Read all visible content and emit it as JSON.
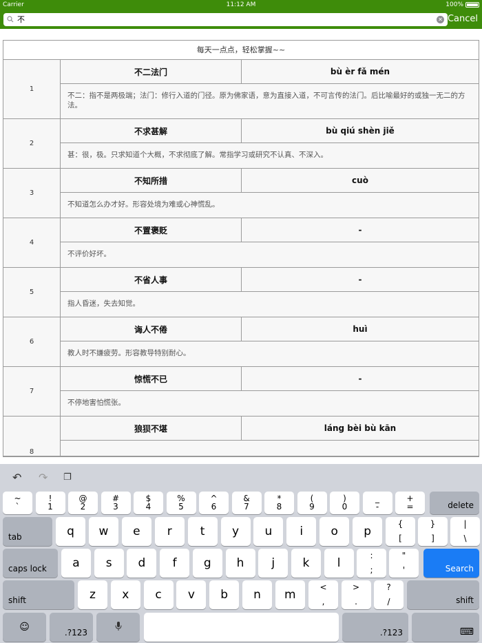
{
  "status": {
    "carrier": "Carrier",
    "time": "11:12 AM",
    "battery": "100%"
  },
  "search": {
    "value": "不",
    "cancel_label": "Cancel"
  },
  "table": {
    "title": "每天一点点，轻松掌握~~",
    "rows": [
      {
        "num": "1",
        "word": "不二法门",
        "pinyin": "bù èr fǎ mén",
        "meaning": "不二：指不是两极端；法门：修行入道的门径。原为佛家语，意为直接入道，不可言传的法门。后比喻最好的或独一无二的方法。"
      },
      {
        "num": "2",
        "word": "不求甚解",
        "pinyin": "bù qiú shèn jiě",
        "meaning": "甚：很，极。只求知道个大概，不求彻底了解。常指学习或研究不认真、不深入。"
      },
      {
        "num": "3",
        "word": "不知所措",
        "pinyin": "cuò",
        "meaning": "不知道怎么办才好。形容处境为难或心神慌乱。"
      },
      {
        "num": "4",
        "word": "不置褒贬",
        "pinyin": "-",
        "meaning": "不评价好坏。"
      },
      {
        "num": "5",
        "word": "不省人事",
        "pinyin": "-",
        "meaning": "指人昏迷，失去知觉。"
      },
      {
        "num": "6",
        "word": "诲人不倦",
        "pinyin": "huì",
        "meaning": "教人时不嫌疲劳。形容教导特别耐心。"
      },
      {
        "num": "7",
        "word": "惊慌不已",
        "pinyin": "-",
        "meaning": "不停地害怕慌张。"
      },
      {
        "num": "8",
        "word": "狼狈不堪",
        "pinyin": "láng bèi bù kān",
        "meaning": ""
      }
    ]
  },
  "keyboard": {
    "row1": [
      {
        "top": "~",
        "bot": "`"
      },
      {
        "top": "!",
        "bot": "1"
      },
      {
        "top": "@",
        "bot": "2"
      },
      {
        "top": "#",
        "bot": "3"
      },
      {
        "top": "$",
        "bot": "4"
      },
      {
        "top": "%",
        "bot": "5"
      },
      {
        "top": "^",
        "bot": "6"
      },
      {
        "top": "&",
        "bot": "7"
      },
      {
        "top": "*",
        "bot": "8"
      },
      {
        "top": "(",
        "bot": "9"
      },
      {
        "top": ")",
        "bot": "0"
      },
      {
        "top": "_",
        "bot": "-"
      },
      {
        "top": "+",
        "bot": "="
      }
    ],
    "delete": "delete",
    "tab": "tab",
    "row2": [
      "q",
      "w",
      "e",
      "r",
      "t",
      "y",
      "u",
      "i",
      "o",
      "p"
    ],
    "row2_punct": [
      {
        "top": "{",
        "bot": "["
      },
      {
        "top": "}",
        "bot": "]"
      },
      {
        "top": "|",
        "bot": "\\"
      }
    ],
    "caps": "caps lock",
    "row3": [
      "a",
      "s",
      "d",
      "f",
      "g",
      "h",
      "j",
      "k",
      "l"
    ],
    "row3_punct": [
      {
        "top": ":",
        "bot": ";"
      },
      {
        "top": "\"",
        "bot": "'"
      }
    ],
    "search": "Search",
    "shift": "shift",
    "row4": [
      "z",
      "x",
      "c",
      "v",
      "b",
      "n",
      "m"
    ],
    "row4_punct": [
      {
        "top": "<",
        "bot": ","
      },
      {
        "top": ">",
        "bot": "."
      },
      {
        "top": "?",
        "bot": "/"
      }
    ],
    "num_label": ".?123",
    "emoji": "☺",
    "mic": "🎤",
    "hide": "⌨"
  }
}
